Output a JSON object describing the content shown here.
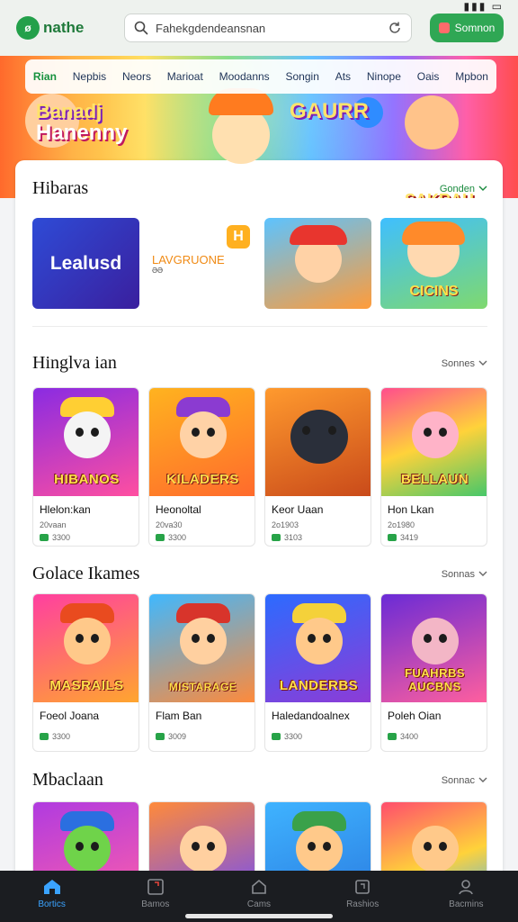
{
  "status": {
    "signal": "▮▮▮ ▭"
  },
  "header": {
    "logo_mark": "ø",
    "logo_text": "nathe",
    "search_value": "Fahekgdendeansnan",
    "button_label": "Somnon"
  },
  "categories": [
    {
      "label": "Rian",
      "active": true
    },
    {
      "label": "Nepbis",
      "active": false
    },
    {
      "label": "Neors",
      "active": false
    },
    {
      "label": "Marioat",
      "active": false
    },
    {
      "label": "Moodanns",
      "active": false
    },
    {
      "label": "Songin",
      "active": false
    },
    {
      "label": "Ats",
      "active": false
    },
    {
      "label": "Ninope",
      "active": false
    },
    {
      "label": "Oais",
      "active": false
    },
    {
      "label": "Mpbon",
      "active": false
    }
  ],
  "banner": {
    "title_line1": "Banadj",
    "title_line2": "Hanenny",
    "title_mid": "GAURR",
    "title_right": "SAKRAH"
  },
  "sections": {
    "featured": {
      "title": "Hibaras",
      "see_more": "Gonden",
      "tiles": [
        {
          "label": "Lealusd"
        },
        {
          "label": "LAVGRUONE",
          "sub": "ƏƏ",
          "badge": "H"
        },
        {
          "label": ""
        },
        {
          "label": "CICINS"
        }
      ]
    },
    "popular": {
      "title": "Hinglva ian",
      "see_more": "Sonnes",
      "cards": [
        {
          "thumb_label": "HIBANOS",
          "name": "Hlelon:kan",
          "meta1": "20vaan",
          "meta2": "3300"
        },
        {
          "thumb_label": "KILADERS",
          "name": "Heonoltal",
          "meta1": "20va30",
          "meta2": "3300"
        },
        {
          "thumb_label": "",
          "name": "Keor Uaan",
          "meta1": "2o1903",
          "meta2": "3103"
        },
        {
          "thumb_label": "BELLAUN",
          "name": "Hon Lkan",
          "meta1": "2o1980",
          "meta2": "3419"
        }
      ]
    },
    "new": {
      "title": "Golace Ikames",
      "see_more": "Sonnas",
      "cards": [
        {
          "thumb_label": "MASRAILS",
          "name": "Foeol Joana",
          "meta1": "",
          "meta2": "3300"
        },
        {
          "thumb_label": "MISTARAGE",
          "name": "Flam Ban",
          "meta1": "",
          "meta2": "3009"
        },
        {
          "thumb_label": "LANDERBS",
          "name": "Haledandoalnex",
          "meta1": "",
          "meta2": "3300"
        },
        {
          "thumb_label": "FUAHRBS AUCBNS",
          "name": "Poleh Oian",
          "meta1": "",
          "meta2": "3400"
        }
      ]
    },
    "more": {
      "title": "Mbaclaan",
      "see_more": "Sonnac"
    }
  },
  "bottom_nav": [
    {
      "label": "Bortics",
      "icon": "home-icon",
      "active": true
    },
    {
      "label": "Bamos",
      "icon": "games-icon",
      "active": false
    },
    {
      "label": "Cams",
      "icon": "cams-icon",
      "active": false
    },
    {
      "label": "Rashios",
      "icon": "rashios-icon",
      "active": false
    },
    {
      "label": "Bacmins",
      "icon": "profile-icon",
      "active": false
    }
  ],
  "colors": {
    "brand_green": "#2fa754",
    "nav_active": "#3aa3ff",
    "nav_bg": "#1b1d21"
  }
}
